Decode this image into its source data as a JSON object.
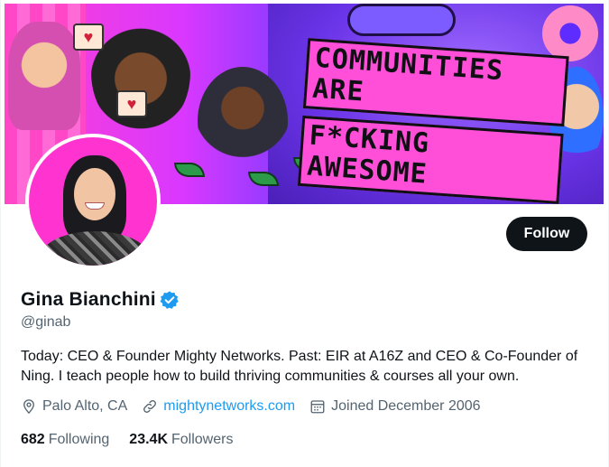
{
  "banner": {
    "headline_line1": "COMMUNITIES ARE",
    "headline_line2": "F*CKING AWESOME"
  },
  "profile": {
    "display_name": "Gina Bianchini",
    "verified_icon": "verified-badge-icon",
    "handle": "@ginab",
    "bio": "Today: CEO & Founder Mighty Networks. Past: EIR at A16Z and CEO & Co-Founder of Ning. I teach people how to build thriving communities & courses all your own.",
    "location": "Palo Alto, CA",
    "website": "mightynetworks.com",
    "joined": "Joined December 2006",
    "following_count": "682",
    "following_label": "Following",
    "followers_count": "23.4K",
    "followers_label": "Followers"
  },
  "actions": {
    "follow_label": "Follow"
  },
  "colors": {
    "accent": "#1d9bf0",
    "text_primary": "#0f1419",
    "text_secondary": "#536471",
    "button_bg": "#0f1419",
    "banner_pink": "#ff3fd2",
    "banner_purple": "#6a34e8"
  }
}
